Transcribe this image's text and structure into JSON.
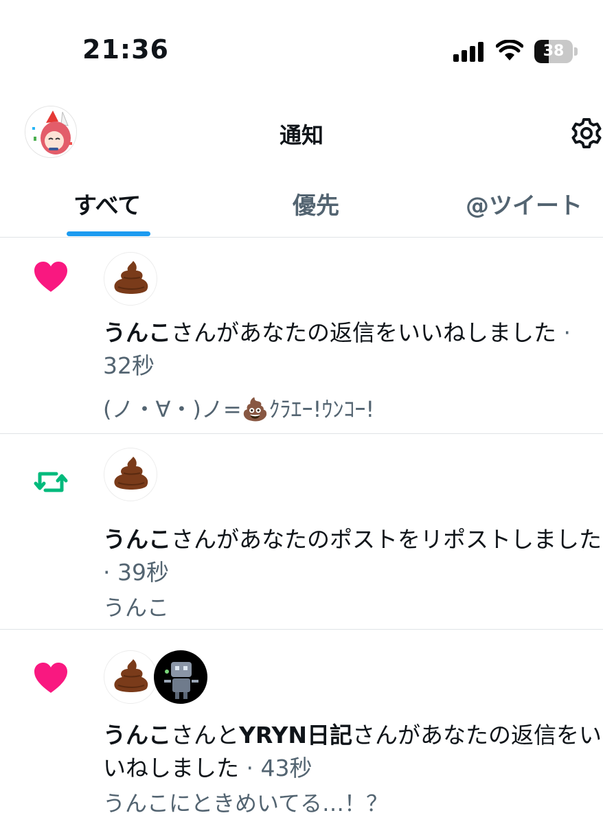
{
  "status_bar": {
    "time": "21:36",
    "battery_level": "38",
    "battery_fraction": 0.38
  },
  "header": {
    "title": "通知"
  },
  "tabs": [
    {
      "label": "すべて",
      "active": true
    },
    {
      "label": "優先",
      "active": false
    },
    {
      "label": "@ツイート",
      "active": false
    }
  ],
  "notifications": [
    {
      "type": "like",
      "icon": "heart-icon",
      "name": "うんこ",
      "action": "さんがあなたの返信をいいねしました",
      "separator": " · ",
      "time": "32秒",
      "preview": "(ノ・∀・)ノ=💩ｸﾗｴｰ!ｳﾝｺｰ!"
    },
    {
      "type": "repost",
      "icon": "repost-icon",
      "name": "うんこ",
      "action": "さんがあなたのポストをリポストしました",
      "separator": " · ",
      "time": "39秒",
      "preview": "うんこ"
    },
    {
      "type": "like",
      "icon": "heart-icon",
      "name": "うんこ",
      "connector": "さんと",
      "name2": "YRYN日記",
      "action": "さんがあなたの返信をいいねしました",
      "separator": " · ",
      "time": "43秒",
      "preview": "うんこにときめいてる…！？"
    }
  ],
  "colors": {
    "like": "#f91880",
    "repost": "#00ba7c",
    "accent": "#1d9bf0",
    "muted": "#536471",
    "text": "#0f1419"
  }
}
